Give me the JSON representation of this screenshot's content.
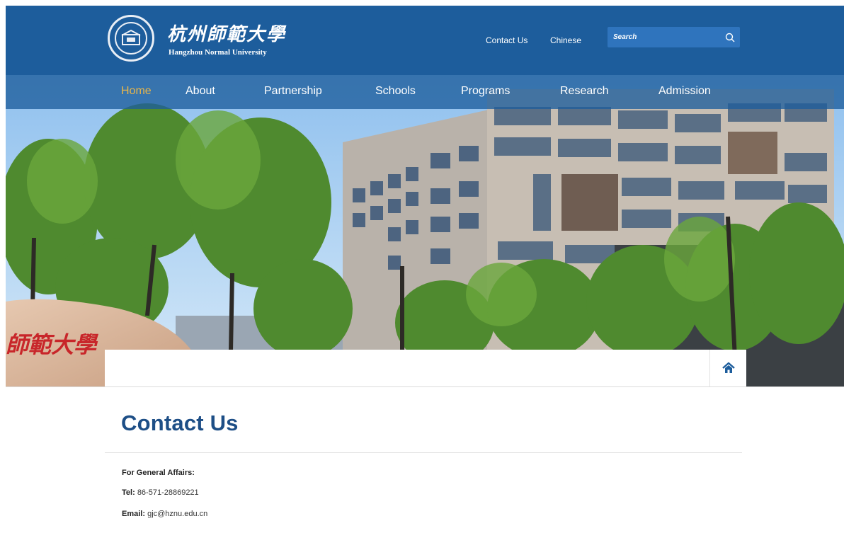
{
  "header": {
    "logo_cn": "杭州師範大學",
    "logo_en": "Hangzhou Normal University",
    "links": {
      "contact": "Contact Us",
      "chinese": "Chinese"
    },
    "search": {
      "placeholder": "Search",
      "icon": "search-icon"
    },
    "colors": {
      "bar": "#1d5d9c",
      "search_bg": "#2f74bd"
    }
  },
  "nav": {
    "items": [
      "Home",
      "About",
      "Partnership",
      "Schools",
      "Programs",
      "Research",
      "Admission"
    ],
    "active": "Home",
    "active_color": "#e8b54a"
  },
  "hero": {
    "rock_text": "師範大學"
  },
  "breadcrumb": {
    "home_icon": "home-icon"
  },
  "main": {
    "title": "Contact Us",
    "title_color": "#1d4e86",
    "general_affairs_label": "For General Affairs:",
    "tel_label": "Tel:",
    "tel_value": "86-571-28869221",
    "email_label": "Email:",
    "email_value": "gjc@hznu.edu.cn"
  }
}
